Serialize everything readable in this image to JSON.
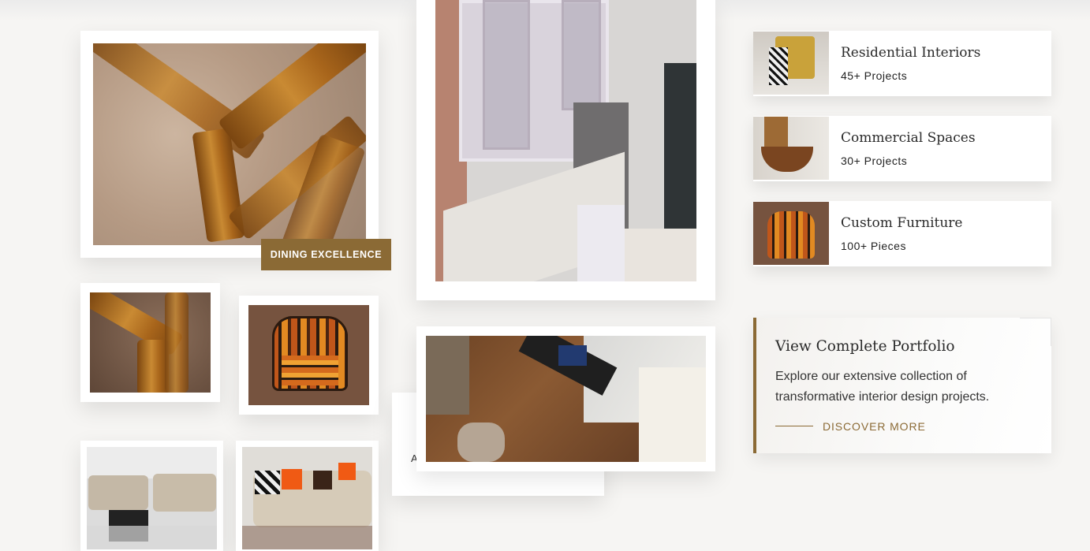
{
  "gallery": {
    "main_badge": "DINING EXCELLENCE",
    "hidden_card_text": "A"
  },
  "categories": [
    {
      "title": "Residential Interiors",
      "count": "45+ Projects"
    },
    {
      "title": "Commercial Spaces",
      "count": "30+ Projects"
    },
    {
      "title": "Custom Furniture",
      "count": "100+ Pieces"
    }
  ],
  "portfolio": {
    "title": "View Complete Portfolio",
    "description": "Explore our extensive collection of transformative interior design projects.",
    "cta": "DISCOVER MORE"
  },
  "colors": {
    "accent": "#8b6a35",
    "background": "#f6f5f3"
  }
}
